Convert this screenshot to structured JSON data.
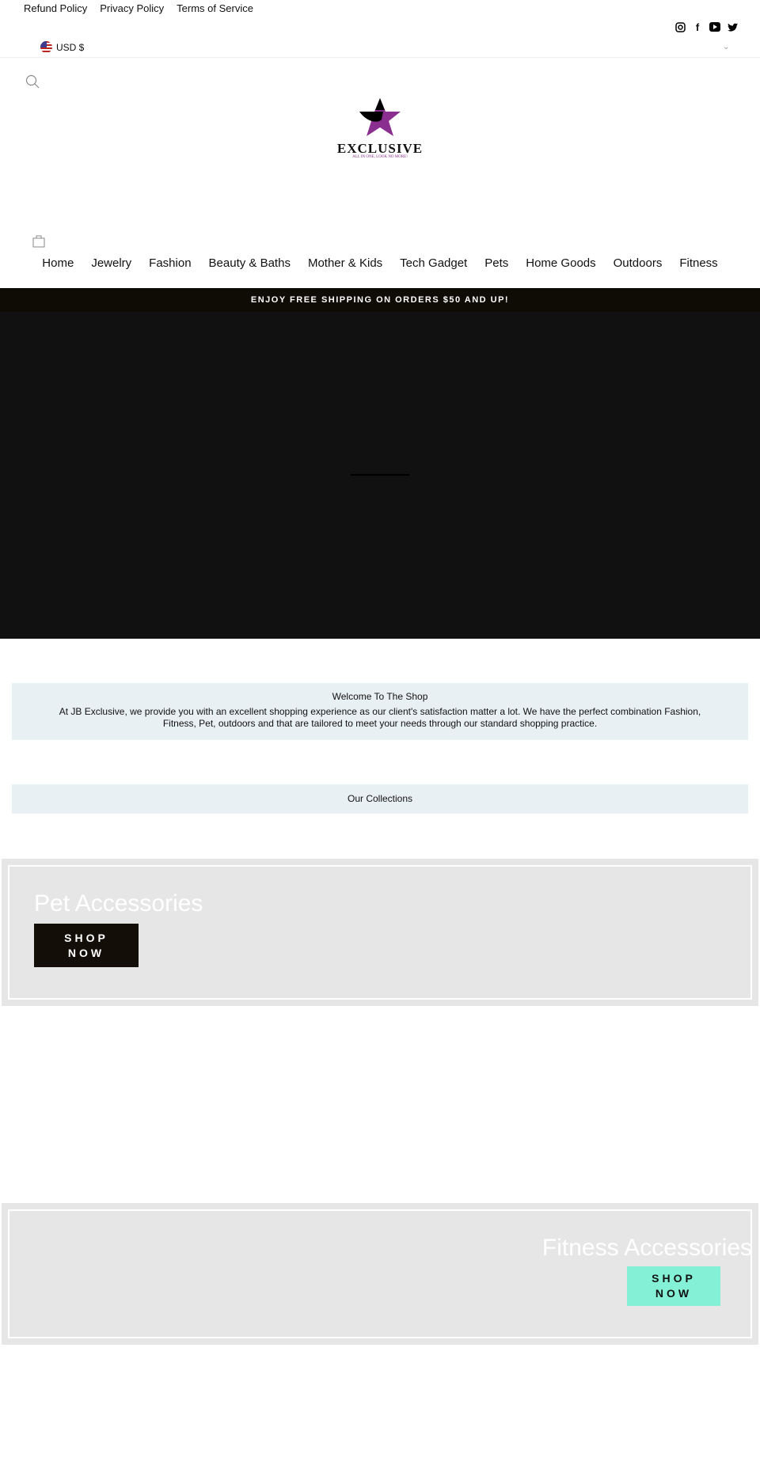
{
  "top_links": [
    "Refund Policy",
    "Privacy Policy",
    "Terms of Service"
  ],
  "social": [
    "instagram",
    "facebook",
    "youtube",
    "twitter"
  ],
  "currency": "USD $",
  "logo": {
    "name": "EXCLUSIVE",
    "tagline": "ALL IN ONE, LOOK NO MORE!",
    "mark": "Jb"
  },
  "nav": [
    "Home",
    "Jewelry",
    "Fashion",
    "Beauty & Baths",
    "Mother & Kids",
    "Tech Gadget",
    "Pets",
    "Home Goods",
    "Outdoors",
    "Fitness"
  ],
  "announcement": "ENJOY FREE SHIPPING ON ORDERS $50 AND UP!",
  "welcome": {
    "title": "Welcome To The Shop",
    "body": "At JB Exclusive, we provide you with an excellent shopping experience as our client's satisfaction matter a lot. We have the perfect combination Fashion, Fitness, Pet, outdoors and that are tailored to meet your needs through our standard shopping practice."
  },
  "collections_heading": "Our Collections",
  "promos": [
    {
      "title": "Pet Accessories",
      "button": "SHOP NOW",
      "button_color": "#130e07"
    },
    {
      "title": "Fitness Accessories",
      "button": "SHOP NOW",
      "button_color": "#84f0d6"
    }
  ]
}
